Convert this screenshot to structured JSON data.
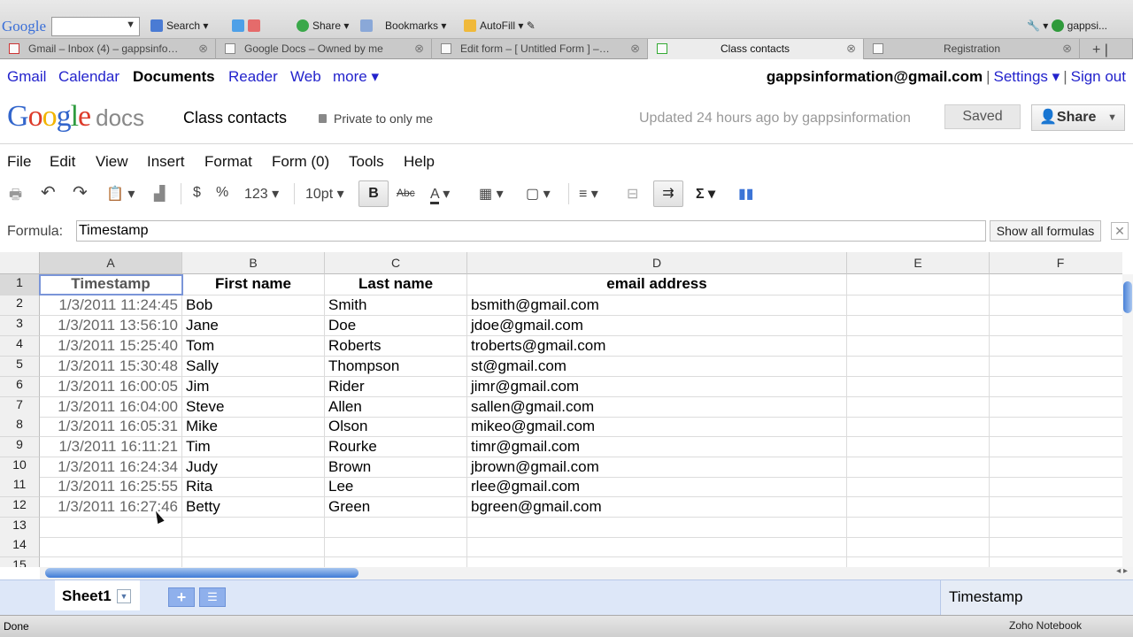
{
  "browser_toolbar": {
    "logo": "Google",
    "search_label": "Search",
    "share_label": "Share",
    "bookmarks_label": "Bookmarks",
    "autofill_label": "AutoFill",
    "user_label": "gappsi..."
  },
  "tabs": [
    {
      "label": "Gmail – Inbox (4) – gappsinfo…"
    },
    {
      "label": "Google Docs – Owned by me"
    },
    {
      "label": "Edit form – [ Untitled Form ] –…"
    },
    {
      "label": "Class contacts"
    },
    {
      "label": "Registration"
    }
  ],
  "gbar": {
    "links": [
      "Gmail",
      "Calendar",
      "Documents",
      "Reader",
      "Web",
      "more ▾"
    ],
    "email": "gappsinformation@gmail.com",
    "settings": "Settings ▾",
    "signout": "Sign out"
  },
  "doc": {
    "logo_google": "Google",
    "logo_docs": "docs",
    "title": "Class contacts",
    "privacy": "Private to only me",
    "updated": "Updated 24 hours ago by gappsinformation",
    "saved": "Saved",
    "share": "Share"
  },
  "menu": [
    "File",
    "Edit",
    "View",
    "Insert",
    "Format",
    "Form (0)",
    "Tools",
    "Help"
  ],
  "toolbar": {
    "currency": "$",
    "percent": "%",
    "number_format": "123",
    "font_size": "10pt",
    "bold": "B",
    "strike": "Abc",
    "sum": "Σ"
  },
  "formula": {
    "label": "Formula:",
    "value": "Timestamp",
    "show_all": "Show all formulas",
    "close": "✕"
  },
  "columns": [
    "A",
    "B",
    "C",
    "D",
    "E",
    "F"
  ],
  "rows": [
    {
      "n": "1",
      "a": "Timestamp",
      "b": "First name",
      "c": "Last name",
      "d": "email address"
    },
    {
      "n": "2",
      "a": "1/3/2011 11:24:45",
      "b": "Bob",
      "c": "Smith",
      "d": "bsmith@gmail.com"
    },
    {
      "n": "3",
      "a": "1/3/2011 13:56:10",
      "b": "Jane",
      "c": "Doe",
      "d": "jdoe@gmail.com"
    },
    {
      "n": "4",
      "a": "1/3/2011 15:25:40",
      "b": "Tom",
      "c": "Roberts",
      "d": "troberts@gmail.com"
    },
    {
      "n": "5",
      "a": "1/3/2011 15:30:48",
      "b": "Sally",
      "c": "Thompson",
      "d": "st@gmail.com"
    },
    {
      "n": "6",
      "a": "1/3/2011 16:00:05",
      "b": "Jim",
      "c": "Rider",
      "d": "jimr@gmail.com"
    },
    {
      "n": "7",
      "a": "1/3/2011 16:04:00",
      "b": "Steve",
      "c": "Allen",
      "d": "sallen@gmail.com"
    },
    {
      "n": "8",
      "a": "1/3/2011 16:05:31",
      "b": "Mike",
      "c": "Olson",
      "d": "mikeo@gmail.com"
    },
    {
      "n": "9",
      "a": "1/3/2011 16:11:21",
      "b": "Tim",
      "c": "Rourke",
      "d": "timr@gmail.com"
    },
    {
      "n": "10",
      "a": "1/3/2011 16:24:34",
      "b": "Judy",
      "c": "Brown",
      "d": "jbrown@gmail.com"
    },
    {
      "n": "11",
      "a": "1/3/2011 16:25:55",
      "b": "Rita",
      "c": "Lee",
      "d": "rlee@gmail.com"
    },
    {
      "n": "12",
      "a": "1/3/2011 16:27:46",
      "b": "Betty",
      "c": "Green",
      "d": "bgreen@gmail.com"
    },
    {
      "n": "13",
      "a": "",
      "b": "",
      "c": "",
      "d": ""
    },
    {
      "n": "14",
      "a": "",
      "b": "",
      "c": "",
      "d": ""
    },
    {
      "n": "15",
      "a": "",
      "b": "",
      "c": "",
      "d": ""
    }
  ],
  "sheets": {
    "active": "Sheet1",
    "cell_value": "Timestamp"
  },
  "status": {
    "text": "Done",
    "zoho": "Zoho Notebook"
  }
}
